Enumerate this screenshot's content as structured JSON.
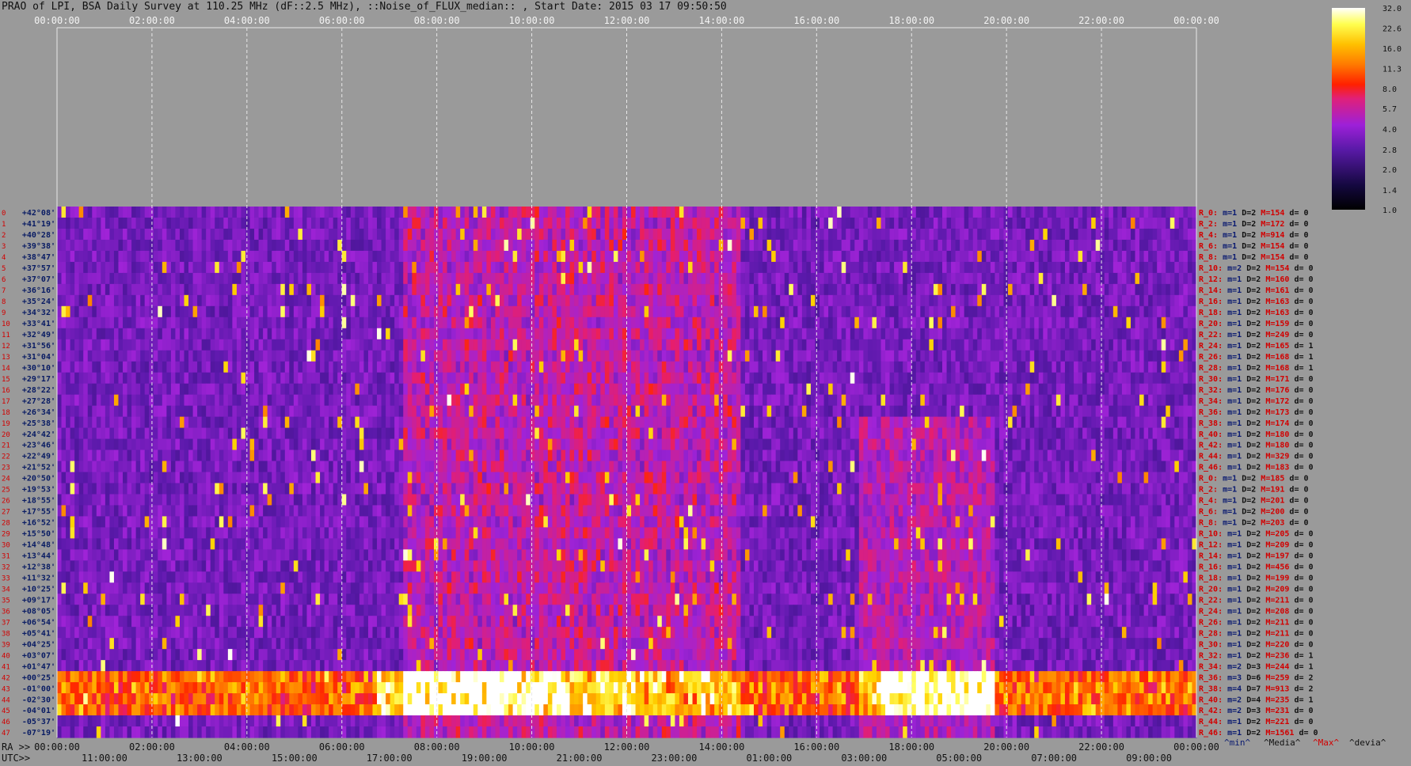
{
  "title": "PRAO of LPI, BSA Daily Survey at 110.25 MHz (dF::2.5 MHz), ::Noise_of_FLUX_median:: , Start Date: 2015 03 17 09:50:50",
  "colors": {
    "background": "#9a9a9a",
    "accent_red": "#d20000",
    "accent_blue": "#0a1a70"
  },
  "chart_data": {
    "type": "heatmap",
    "title": "PRAO of LPI, BSA Daily Survey at 110.25 MHz (dF::2.5 MHz), ::Noise_of_FLUX_median:: , Start Date: 2015 03 17 09:50:50",
    "ra_ticks": [
      "00:00:00",
      "02:00:00",
      "04:00:00",
      "06:00:00",
      "08:00:00",
      "10:00:00",
      "12:00:00",
      "14:00:00",
      "16:00:00",
      "18:00:00",
      "20:00:00",
      "22:00:00",
      "00:00:00"
    ],
    "ra_prefix": "RA >>",
    "utc_prefix": "UTC>>",
    "utc_ticks": [
      "11:00:00",
      "13:00:00",
      "15:00:00",
      "17:00:00",
      "19:00:00",
      "21:00:00",
      "23:00:00",
      "01:00:00",
      "03:00:00",
      "05:00:00",
      "07:00:00",
      "09:00:00"
    ],
    "declinations": [
      "+42°08'",
      "+41°19'",
      "+40°28'",
      "+39°38'",
      "+38°47'",
      "+37°57'",
      "+37°07'",
      "+36°16'",
      "+35°24'",
      "+34°32'",
      "+33°41'",
      "+32°49'",
      "+31°56'",
      "+31°04'",
      "+30°10'",
      "+29°17'",
      "+28°22'",
      "+27°28'",
      "+26°34'",
      "+25°38'",
      "+24°42'",
      "+23°46'",
      "+22°49'",
      "+21°52'",
      "+20°50'",
      "+19°53'",
      "+18°55'",
      "+17°55'",
      "+16°52'",
      "+15°50'",
      "+14°48'",
      "+13°44'",
      "+12°38'",
      "+11°32'",
      "+10°25'",
      "+09°17'",
      "+08°05'",
      "+06°54'",
      "+05°41'",
      "+04°25'",
      "+03°07'",
      "+01°47'",
      "+00°25'",
      "-01°00'",
      "-02°30'",
      "-04°01'",
      "-05°37'",
      "-07°19'"
    ],
    "row_index_labels": [
      "0",
      "1",
      "2",
      "3",
      "4",
      "5",
      "6",
      "7",
      "8",
      "9",
      "10",
      "11",
      "12",
      "13",
      "14",
      "15",
      "16",
      "17",
      "18",
      "19",
      "20",
      "21",
      "22",
      "23",
      "24",
      "25",
      "26",
      "27",
      "28",
      "29",
      "30",
      "31",
      "32",
      "33",
      "34",
      "35",
      "36",
      "37",
      "38",
      "39",
      "40",
      "41",
      "42",
      "43",
      "44",
      "45",
      "46",
      "47"
    ],
    "colorbar": {
      "ticks": [
        "32.0",
        "22.6",
        "16.0",
        "11.3",
        "8.0",
        "5.7",
        "4.0",
        "2.8",
        "2.0",
        "1.4",
        "1.0"
      ],
      "scale": "log2",
      "range": [
        1.0,
        32.0
      ]
    },
    "stats": [
      {
        "r": "R_0:",
        "m": "m=1",
        "d": "D=2",
        "M": "M=154",
        "dev": "d= 0"
      },
      {
        "r": "R_2:",
        "m": "m=1",
        "d": "D=2",
        "M": "M=172",
        "dev": "d= 0"
      },
      {
        "r": "R_4:",
        "m": "m=1",
        "d": "D=2",
        "M": "M=914",
        "dev": "d= 0"
      },
      {
        "r": "R_6:",
        "m": "m=1",
        "d": "D=2",
        "M": "M=154",
        "dev": "d= 0"
      },
      {
        "r": "R_8:",
        "m": "m=1",
        "d": "D=2",
        "M": "M=154",
        "dev": "d= 0"
      },
      {
        "r": "R_10:",
        "m": "m=2",
        "d": "D=2",
        "M": "M=154",
        "dev": "d= 0"
      },
      {
        "r": "R_12:",
        "m": "m=1",
        "d": "D=2",
        "M": "M=160",
        "dev": "d= 0"
      },
      {
        "r": "R_14:",
        "m": "m=1",
        "d": "D=2",
        "M": "M=161",
        "dev": "d= 0"
      },
      {
        "r": "R_16:",
        "m": "m=1",
        "d": "D=2",
        "M": "M=163",
        "dev": "d= 0"
      },
      {
        "r": "R_18:",
        "m": "m=1",
        "d": "D=2",
        "M": "M=163",
        "dev": "d= 0"
      },
      {
        "r": "R_20:",
        "m": "m=1",
        "d": "D=2",
        "M": "M=159",
        "dev": "d= 0"
      },
      {
        "r": "R_22:",
        "m": "m=1",
        "d": "D=2",
        "M": "M=249",
        "dev": "d= 0"
      },
      {
        "r": "R_24:",
        "m": "m=1",
        "d": "D=2",
        "M": "M=165",
        "dev": "d= 1"
      },
      {
        "r": "R_26:",
        "m": "m=1",
        "d": "D=2",
        "M": "M=168",
        "dev": "d= 1"
      },
      {
        "r": "R_28:",
        "m": "m=1",
        "d": "D=2",
        "M": "M=168",
        "dev": "d= 1"
      },
      {
        "r": "R_30:",
        "m": "m=1",
        "d": "D=2",
        "M": "M=171",
        "dev": "d= 0"
      },
      {
        "r": "R_32:",
        "m": "m=1",
        "d": "D=2",
        "M": "M=176",
        "dev": "d= 0"
      },
      {
        "r": "R_34:",
        "m": "m=1",
        "d": "D=2",
        "M": "M=172",
        "dev": "d= 0"
      },
      {
        "r": "R_36:",
        "m": "m=1",
        "d": "D=2",
        "M": "M=173",
        "dev": "d= 0"
      },
      {
        "r": "R_38:",
        "m": "m=1",
        "d": "D=2",
        "M": "M=174",
        "dev": "d= 0"
      },
      {
        "r": "R_40:",
        "m": "m=1",
        "d": "D=2",
        "M": "M=180",
        "dev": "d= 0"
      },
      {
        "r": "R_42:",
        "m": "m=1",
        "d": "D=2",
        "M": "M=180",
        "dev": "d= 0"
      },
      {
        "r": "R_44:",
        "m": "m=1",
        "d": "D=2",
        "M": "M=329",
        "dev": "d= 0"
      },
      {
        "r": "R_46:",
        "m": "m=1",
        "d": "D=2",
        "M": "M=183",
        "dev": "d= 0"
      },
      {
        "r": "R_0:",
        "m": "m=1",
        "d": "D=2",
        "M": "M=185",
        "dev": "d= 0"
      },
      {
        "r": "R_2:",
        "m": "m=1",
        "d": "D=2",
        "M": "M=191",
        "dev": "d= 0"
      },
      {
        "r": "R_4:",
        "m": "m=1",
        "d": "D=2",
        "M": "M=201",
        "dev": "d= 0"
      },
      {
        "r": "R_6:",
        "m": "m=1",
        "d": "D=2",
        "M": "M=200",
        "dev": "d= 0"
      },
      {
        "r": "R_8:",
        "m": "m=1",
        "d": "D=2",
        "M": "M=203",
        "dev": "d= 0"
      },
      {
        "r": "R_10:",
        "m": "m=1",
        "d": "D=2",
        "M": "M=205",
        "dev": "d= 0"
      },
      {
        "r": "R_12:",
        "m": "m=1",
        "d": "D=2",
        "M": "M=209",
        "dev": "d= 0"
      },
      {
        "r": "R_14:",
        "m": "m=1",
        "d": "D=2",
        "M": "M=197",
        "dev": "d= 0"
      },
      {
        "r": "R_16:",
        "m": "m=1",
        "d": "D=2",
        "M": "M=456",
        "dev": "d= 0"
      },
      {
        "r": "R_18:",
        "m": "m=1",
        "d": "D=2",
        "M": "M=199",
        "dev": "d= 0"
      },
      {
        "r": "R_20:",
        "m": "m=1",
        "d": "D=2",
        "M": "M=209",
        "dev": "d= 0"
      },
      {
        "r": "R_22:",
        "m": "m=1",
        "d": "D=2",
        "M": "M=211",
        "dev": "d= 0"
      },
      {
        "r": "R_24:",
        "m": "m=1",
        "d": "D=2",
        "M": "M=208",
        "dev": "d= 0"
      },
      {
        "r": "R_26:",
        "m": "m=1",
        "d": "D=2",
        "M": "M=211",
        "dev": "d= 0"
      },
      {
        "r": "R_28:",
        "m": "m=1",
        "d": "D=2",
        "M": "M=211",
        "dev": "d= 0"
      },
      {
        "r": "R_30:",
        "m": "m=1",
        "d": "D=2",
        "M": "M=220",
        "dev": "d= 0"
      },
      {
        "r": "R_32:",
        "m": "m=1",
        "d": "D=2",
        "M": "M=236",
        "dev": "d= 1"
      },
      {
        "r": "R_34:",
        "m": "m=2",
        "d": "D=3",
        "M": "M=244",
        "dev": "d= 1"
      },
      {
        "r": "R_36:",
        "m": "m=3",
        "d": "D=6",
        "M": "M=259",
        "dev": "d= 2"
      },
      {
        "r": "R_38:",
        "m": "m=4",
        "d": "D=7",
        "M": "M=913",
        "dev": "d= 2"
      },
      {
        "r": "R_40:",
        "m": "m=2",
        "d": "D=4",
        "M": "M=235",
        "dev": "d= 1"
      },
      {
        "r": "R_42:",
        "m": "m=2",
        "d": "D=3",
        "M": "M=231",
        "dev": "d= 0"
      },
      {
        "r": "R_44:",
        "m": "m=1",
        "d": "D=2",
        "M": "M=221",
        "dev": "d= 0"
      },
      {
        "r": "R_46:",
        "m": "m=1",
        "d": "D=2",
        "M": "M=1561",
        "dev": "d= 0"
      }
    ],
    "stats_legend": {
      "min": "^min^",
      "median": "^Media^",
      "max": "^Max^",
      "dev": "^devia^"
    }
  }
}
